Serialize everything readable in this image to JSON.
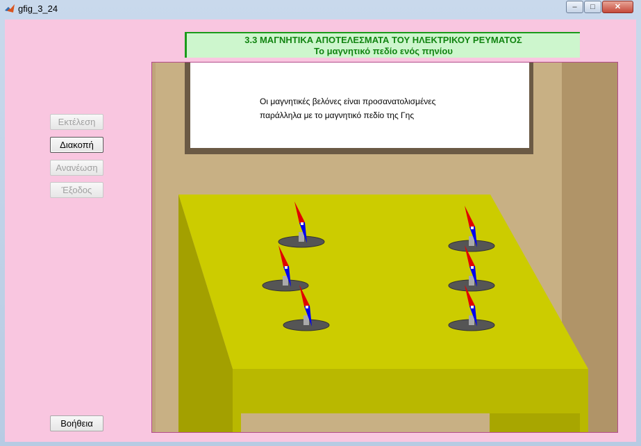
{
  "window": {
    "title": "gfig_3_24",
    "minimize_symbol": "–",
    "maximize_symbol": "□",
    "close_symbol": "✕"
  },
  "header": {
    "line1": "3.3 ΜΑΓΝΗΤΙΚΑ ΑΠΟΤΕΛΕΣΜΑΤΑ ΤΟΥ ΗΛΕΚΤΡΙΚΟΥ ΡΕΥΜΑΤΟΣ",
    "line2": "Το μαγνητικό πεδίο ενός πηνίου",
    "accent_color": "#1a9a1a"
  },
  "buttons": {
    "run": "Εκτέλεση",
    "stop": "Διακοπή",
    "refresh": "Ανανέωση",
    "exit": "Έξοδος",
    "help": "Βοήθεια"
  },
  "board": {
    "line1": "Οι μαγνητικές βελόνες είναι προσανατολισμένες",
    "line2": "παράλληλα με το μαγνητικό πεδίο της Γης"
  },
  "colors": {
    "background": "#f9c6e0",
    "wall": "#c8b084",
    "table_top": "#cccc00",
    "needle_north": "#e00000",
    "needle_south": "#0000ee"
  },
  "compass_count": 6
}
